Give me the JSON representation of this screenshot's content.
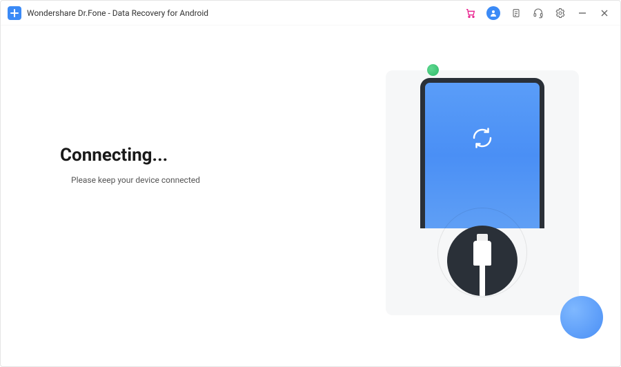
{
  "window": {
    "title": "Wondershare Dr.Fone - Data Recovery for Android"
  },
  "main": {
    "heading": "Connecting...",
    "subtitle": "Please keep your device connected"
  },
  "icons": {
    "cart": "cart-icon",
    "user": "user-icon",
    "clipboard": "clipboard-icon",
    "headset": "headset-icon",
    "gear": "gear-icon",
    "minimize": "minimize-icon",
    "close": "close-icon"
  },
  "colors": {
    "accent": "#3b8af6",
    "cart": "#e91e8c",
    "phone_border": "#2a3038",
    "bg_panel": "#f6f7f8"
  }
}
